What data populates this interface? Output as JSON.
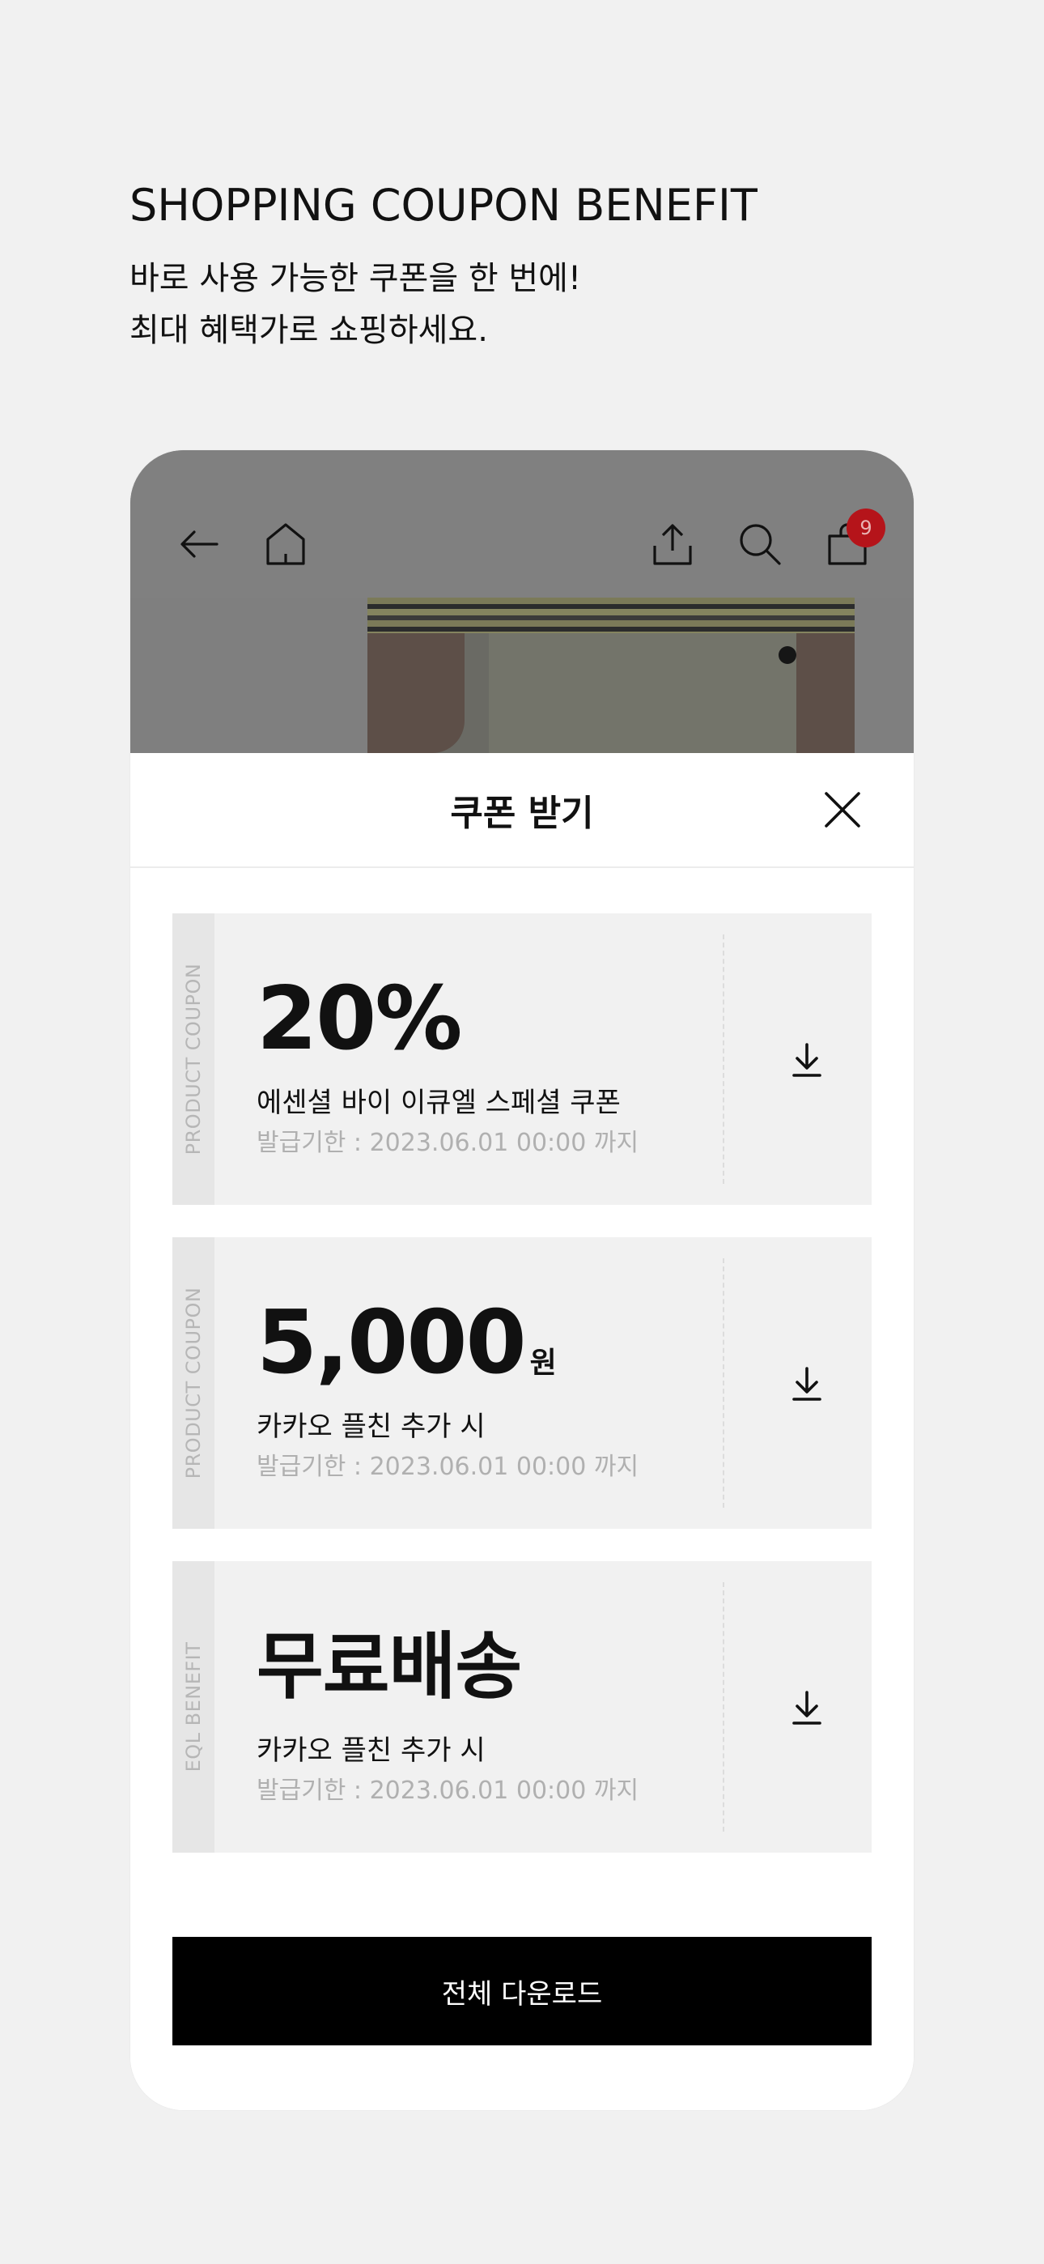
{
  "intro": {
    "title": "SHOPPING COUPON BENEFIT",
    "line1": "바로 사용 가능한 쿠폰을 한 번에!",
    "line2": "최대 혜택가로 쇼핑하세요."
  },
  "topbar": {
    "cart_count": "9",
    "icons": [
      "arrow-left-icon",
      "home-icon",
      "share-icon",
      "search-icon",
      "bag-icon"
    ]
  },
  "sheet": {
    "title": "쿠폰 받기",
    "coupons": [
      {
        "type_label": "PRODUCT COUPON",
        "value": "20%",
        "unit": "",
        "description": "에센셜 바이 이큐엘 스페셜 쿠폰",
        "expiry": "발급기한 : 2023.06.01 00:00 까지"
      },
      {
        "type_label": "PRODUCT COUPON",
        "value": "5,000",
        "unit": "원",
        "description": "카카오 플친 추가 시",
        "expiry": "발급기한 : 2023.06.01 00:00 까지"
      },
      {
        "type_label": "EQL BENEFIT",
        "value": "무료배송",
        "unit": "",
        "description": "카카오 플친 추가 시",
        "expiry": "발급기한 : 2023.06.01 00:00 까지"
      }
    ],
    "download_all_label": "전체 다운로드"
  },
  "colors": {
    "background": "#f1f1f1",
    "badge": "#b5141a",
    "button": "#000000"
  }
}
